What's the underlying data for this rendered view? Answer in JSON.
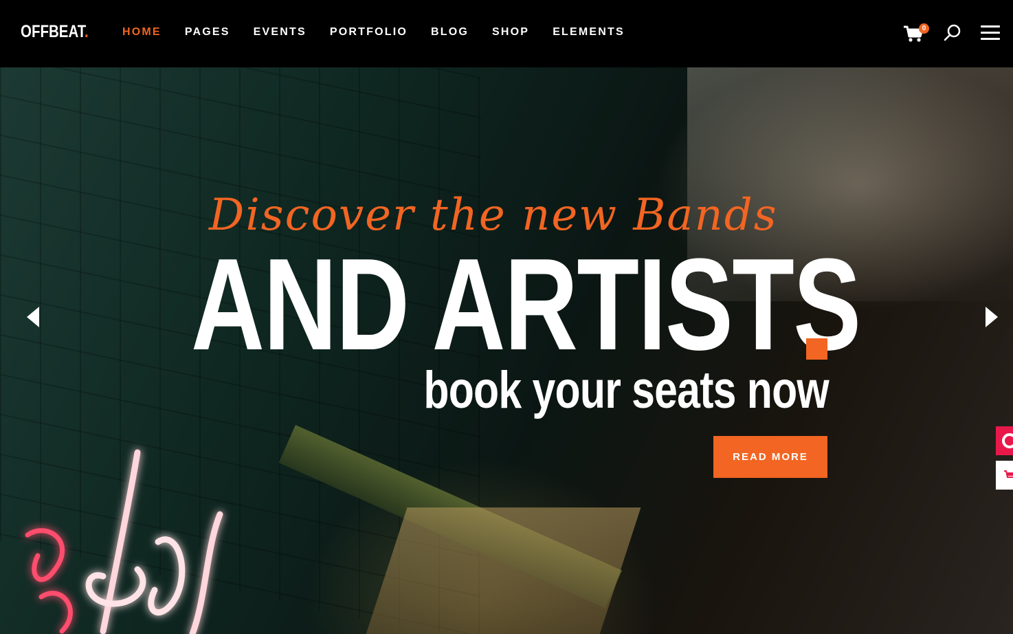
{
  "header": {
    "logo_text": "OFFBEAT",
    "logo_dot": ".",
    "nav": [
      {
        "label": "HOME",
        "active": true
      },
      {
        "label": "PAGES",
        "active": false
      },
      {
        "label": "EVENTS",
        "active": false
      },
      {
        "label": "PORTFOLIO",
        "active": false
      },
      {
        "label": "BLOG",
        "active": false
      },
      {
        "label": "SHOP",
        "active": false
      },
      {
        "label": "ELEMENTS",
        "active": false
      }
    ],
    "cart_count": "0",
    "icons": [
      "cart-icon",
      "search-icon",
      "menu-icon"
    ]
  },
  "hero": {
    "script_text": "Discover the new Bands",
    "headline": "AND ARTISTS",
    "subheadline": "book your seats now",
    "button_label": "READ MORE"
  },
  "colors": {
    "accent": "#f26522",
    "header_bg": "#000000",
    "text": "#ffffff",
    "side_tab_1": "#e8194a",
    "side_tab_2": "#ffffff"
  }
}
